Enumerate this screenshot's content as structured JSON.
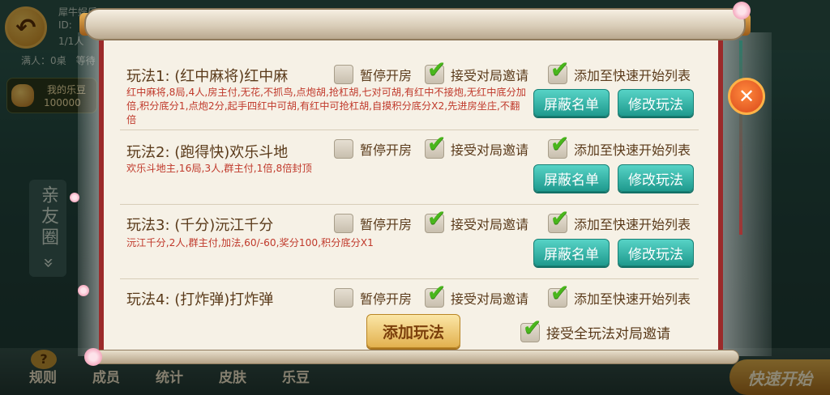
{
  "background": {
    "player_name": "犀牛娱乐",
    "id_label": "ID:",
    "tables_count": "1/1人",
    "table_info": "满人：0桌　等待",
    "coin_label": "我的乐豆",
    "coin_value": "100000",
    "side_tab": "亲友圈 »",
    "bottom_nav": [
      "规则",
      "成员",
      "统计",
      "皮肤",
      "乐豆"
    ],
    "quick_start": "快速开始"
  },
  "dialog": {
    "checkbox_labels": {
      "pause": "暂停开房",
      "accept": "接受对局邀请",
      "add_quick": "添加至快速开始列表"
    },
    "buttons": {
      "block_list": "屏蔽名单",
      "modify": "修改玩法",
      "add_rule": "添加玩法",
      "accept_all": "接受全玩法对局邀请"
    },
    "accept_all_checked": true,
    "rules": [
      {
        "title": "玩法1:  (红中麻将)红中麻",
        "desc": "红中麻将,8局,4人,房主付,无花,不抓鸟,点炮胡,抢杠胡,七对可胡,有红中不接炮,无红中底分加倍,积分底分1,点炮2分,起手四红中可胡,有红中可抢杠胡,自摸积分底分X2,先进房坐庄,不翻倍",
        "pause": false,
        "accept": true,
        "add_quick": true
      },
      {
        "title": "玩法2:  (跑得快)欢乐斗地",
        "desc": "欢乐斗地主,16局,3人,群主付,1倍,8倍封顶",
        "pause": false,
        "accept": true,
        "add_quick": true
      },
      {
        "title": "玩法3:  (千分)沅江千分",
        "desc": "沅江千分,2人,群主付,加法,60/-60,奖分100,积分底分X1",
        "pause": false,
        "accept": true,
        "add_quick": true
      },
      {
        "title": "玩法4:  (打炸弹)打炸弹",
        "desc": "",
        "pause": false,
        "accept": true,
        "add_quick": true
      }
    ]
  }
}
